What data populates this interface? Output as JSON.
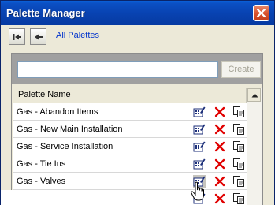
{
  "window": {
    "title": "Palette Manager"
  },
  "nav": {
    "first_icon": "arrow-first-icon",
    "back_icon": "arrow-back-icon",
    "all_palettes_link": "All Palettes"
  },
  "search": {
    "value": "",
    "create_label": "Create"
  },
  "table": {
    "header": "Palette Name",
    "rows": [
      {
        "label": "Gas - Abandon Items"
      },
      {
        "label": "Gas - New Main Installation"
      },
      {
        "label": "Gas - Service Installation"
      },
      {
        "label": "Gas - Tie Ins"
      },
      {
        "label": "Gas - Valves"
      }
    ],
    "row_actions": [
      "edit-icon",
      "delete-icon",
      "copy-icon"
    ]
  },
  "colors": {
    "title_bar": "#0842b0",
    "close_button": "#d9542f",
    "link": "#0033cc",
    "delete_icon": "#e00000"
  }
}
